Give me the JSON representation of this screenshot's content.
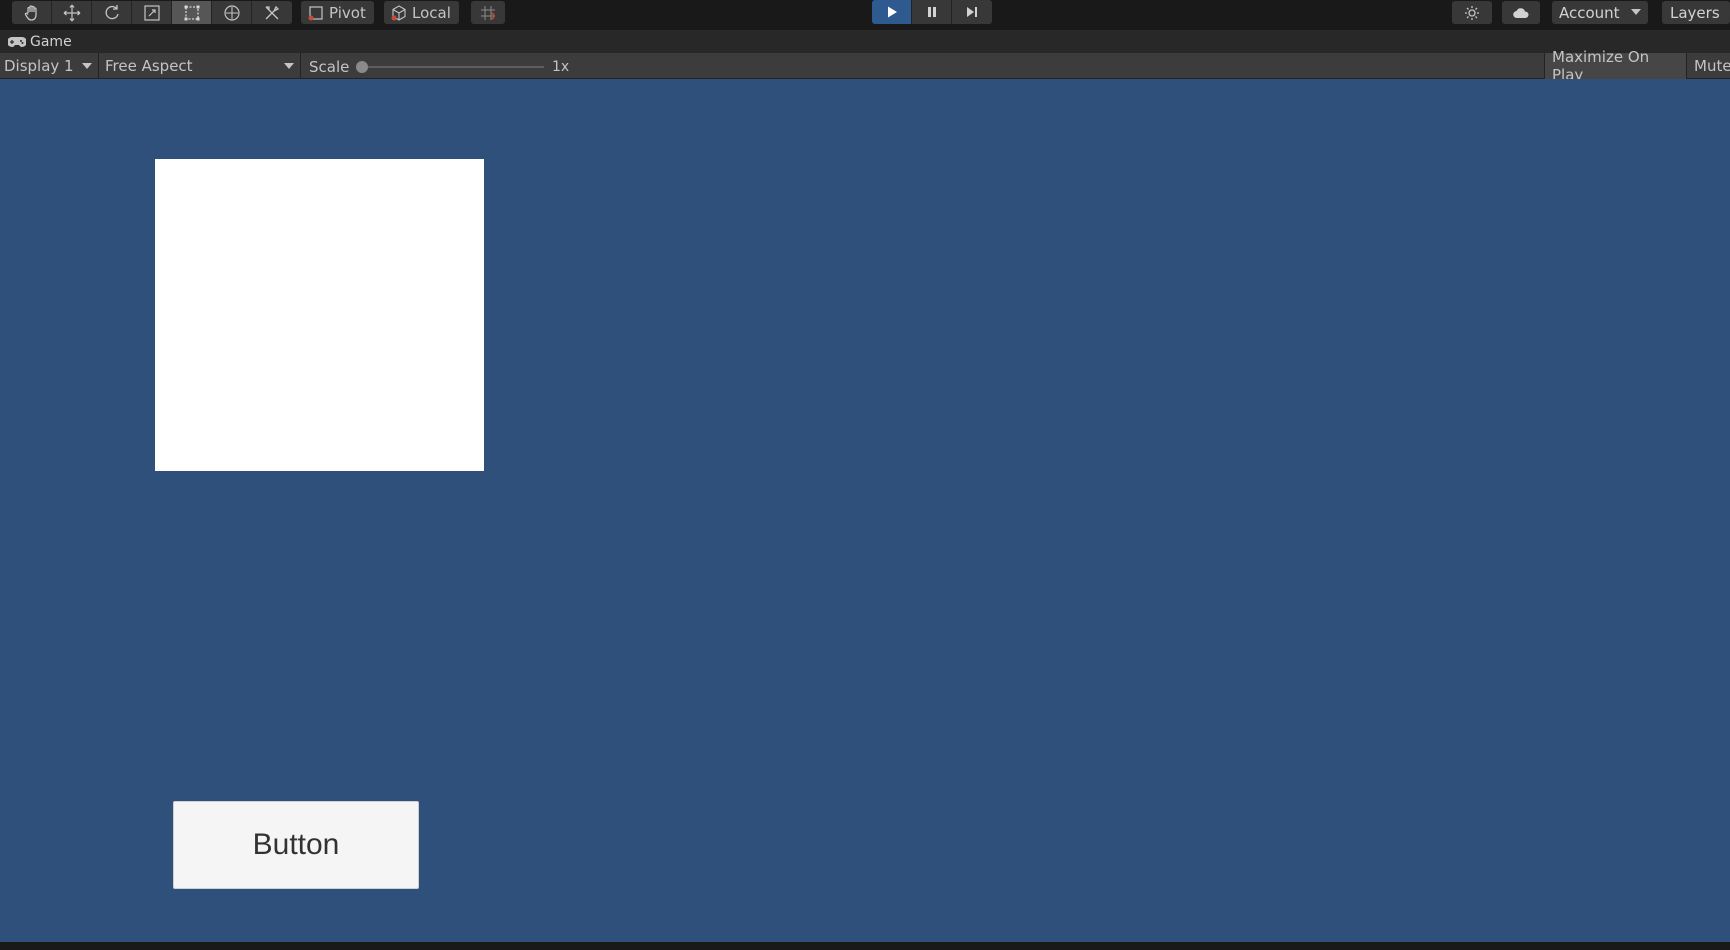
{
  "toolbar": {
    "tools": [
      {
        "name": "hand-icon"
      },
      {
        "name": "move-icon"
      },
      {
        "name": "rotate-icon"
      },
      {
        "name": "scale-icon"
      },
      {
        "name": "rect-transform-icon",
        "active": true
      },
      {
        "name": "transform-icon"
      },
      {
        "name": "custom-tool-icon"
      }
    ],
    "pivot_label": "Pivot",
    "local_label": "Local",
    "grid_snap_icon": "grid-snap-icon",
    "play_icon": "play-icon",
    "pause_icon": "pause-icon",
    "step_icon": "step-icon",
    "services_icon": "services-icon",
    "cloud_icon": "cloud-icon",
    "account_label": "Account",
    "layers_label": "Layers"
  },
  "game_tab": {
    "icon": "gamepad-icon",
    "label": "Game"
  },
  "game_toolbar": {
    "display_selected": "Display 1",
    "aspect_selected": "Free Aspect",
    "scale_label": "Scale",
    "scale_value": "1x",
    "scale_fraction": 0.0,
    "maximize_label": "Maximize On Play",
    "mute_label": "Mute"
  },
  "scene": {
    "button_label": "Button"
  },
  "colors": {
    "viewport_bg": "#30507c",
    "play_active": "#2e5a8f",
    "editor_dark": "#191919"
  }
}
